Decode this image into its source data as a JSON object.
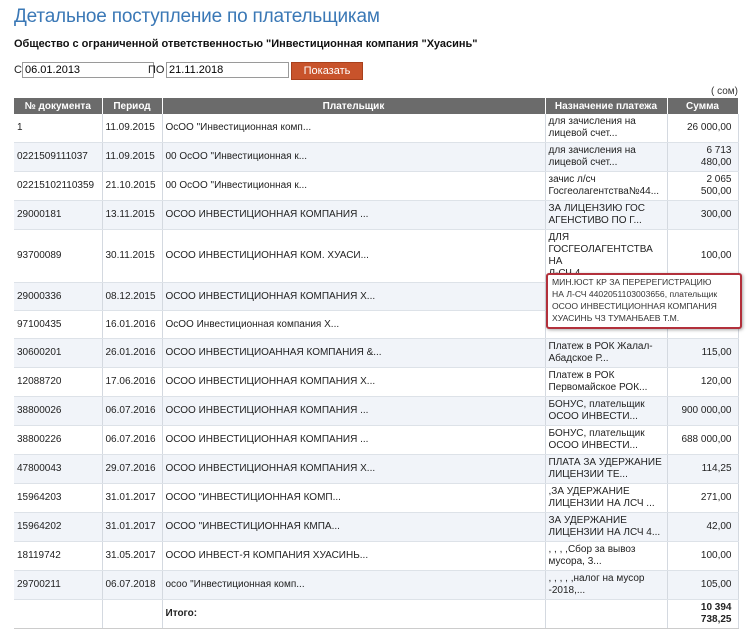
{
  "page": {
    "title": "Детальное поступление по плательщикам",
    "company": "Общество с ограниченной ответственностью \"Инвестиционная компания \"Хуасинь\""
  },
  "filter": {
    "from_label": "С",
    "from_value": "06.01.2013",
    "to_label": "ПО",
    "to_value": "21.11.2018",
    "show_button": "Показать"
  },
  "unit_label": "( сом)",
  "table": {
    "headers": [
      "№ документа",
      "Период",
      "Плательщик",
      "Назначение платежа",
      "Сумма"
    ],
    "rows": [
      {
        "doc": "1",
        "date": "11.09.2015",
        "payer": "ОсОО \"Инвестиционная комп...",
        "purpose": "для зачисления на\nлицевой счет...",
        "amount": "26 000,00"
      },
      {
        "doc": "0221509111037",
        "date": "11.09.2015",
        "payer": "00 ОсОО \"Инвестиционная к...",
        "purpose": "для зачисления на\nлицевой счет...",
        "amount": "6 713\n480,00"
      },
      {
        "doc": "02215102110359",
        "date": "21.10.2015",
        "payer": "00 ОсОО \"Инвестиционная к...",
        "purpose": "зачис л/сч\nГосгеолагентства№44...",
        "amount": "2 065\n500,00"
      },
      {
        "doc": "29000181",
        "date": "13.11.2015",
        "payer": "ОСОО ИНВЕСТИЦИОННАЯ КОМПАНИЯ ...",
        "purpose": "ЗА ЛИЦЕНЗИЮ ГОС\nАГЕНСТИВО ПО Г...",
        "amount": "300,00"
      },
      {
        "doc": "93700089",
        "date": "30.11.2015",
        "payer": "ОСОО ИНВЕСТИЦИОННАЯ КОМ. ХУАСИ...",
        "purpose": "ДЛЯ\nГОСГЕОЛАГЕНТСТВА НА\nЛ-СЧ 4...",
        "amount": "100,00"
      },
      {
        "doc": "29000336",
        "date": "08.12.2015",
        "payer": "ОСОО ИНВЕСТИЦИОННАЯ КОМПАНИЯ Х...",
        "purpose": "МИН.ЮСТ КР ЗА",
        "amount": ""
      },
      {
        "doc": "97100435",
        "date": "16.01.2016",
        "payer": "ОсОО Инвестиционная компания Х...",
        "purpose": "",
        "amount": ""
      },
      {
        "doc": "30600201",
        "date": "26.01.2016",
        "payer": "ОСОО ИНВЕСТИЦИОАННАЯ КОМПАНИЯ &...",
        "purpose": "Платеж в РОК Жалал-\nАбадское Р...",
        "amount": "115,00"
      },
      {
        "doc": "12088720",
        "date": "17.06.2016",
        "payer": "ОСОО ИНВЕСТИЦИОННАЯ КОМПАНИЯ Х...",
        "purpose": "Платеж в РОК\nПервомайское РОК...",
        "amount": "120,00"
      },
      {
        "doc": "38800026",
        "date": "06.07.2016",
        "payer": "ОСОО ИНВЕСТИЦИОННАЯ КОМПАНИЯ ...",
        "purpose": "БОНУС, плательщик\nОСОО ИНВЕСТИ...",
        "amount": "900 000,00"
      },
      {
        "doc": "38800226",
        "date": "06.07.2016",
        "payer": "ОСОО ИНВЕСТИЦИОННАЯ КОМПАНИЯ ...",
        "purpose": "БОНУС, плательщик\nОСОО ИНВЕСТИ...",
        "amount": "688 000,00"
      },
      {
        "doc": "47800043",
        "date": "29.07.2016",
        "payer": "ОСОО ИНВЕСТИЦИОННАЯ КОМПАНИЯ Х...",
        "purpose": "ПЛАТА ЗА УДЕРЖАНИЕ\nЛИЦЕНЗИИ ТЕ...",
        "amount": "114,25"
      },
      {
        "doc": "15964203",
        "date": "31.01.2017",
        "payer": "ОСОО \"ИНВЕСТИЦИОННАЯ КОМП...",
        "purpose": ",ЗА УДЕРЖАНИЕ\nЛИЦЕНЗИИ НА ЛСЧ ...",
        "amount": "271,00"
      },
      {
        "doc": "15964202",
        "date": "31.01.2017",
        "payer": "ОСОО \"ИНВЕСТИЦИОННАЯ КМПА...",
        "purpose": "ЗА УДЕРЖАНИЕ\nЛИЦЕНЗИИ НА ЛСЧ 4...",
        "amount": "42,00"
      },
      {
        "doc": "18119742",
        "date": "31.05.2017",
        "payer": "ОСОО ИНВЕСТ-Я КОМПАНИЯ ХУАСИНЬ...",
        "purpose": ", , , ,Сбор за вывоз\nмусора, 3...",
        "amount": "100,00"
      },
      {
        "doc": "29700211",
        "date": "06.07.2018",
        "payer": "осоо \"Инвестиционная комп...",
        "purpose": ", , , , ,налог на мусор\n-2018,...",
        "amount": "105,00"
      }
    ],
    "total_label": "Итого:",
    "total_amount": "10 394 738,25"
  },
  "tooltip": {
    "text": "МИН.ЮСТ КР ЗА  ПЕРЕРЕГИСТРАЦИЮ\nНА Л-СЧ 4402051103003656, плательщик\nОСОО ИНВЕСТИЦИОННАЯ КОМПАНИЯ\nХУАСИНЬ ЧЗ ТУМАНБАЕВ  Т.М."
  }
}
